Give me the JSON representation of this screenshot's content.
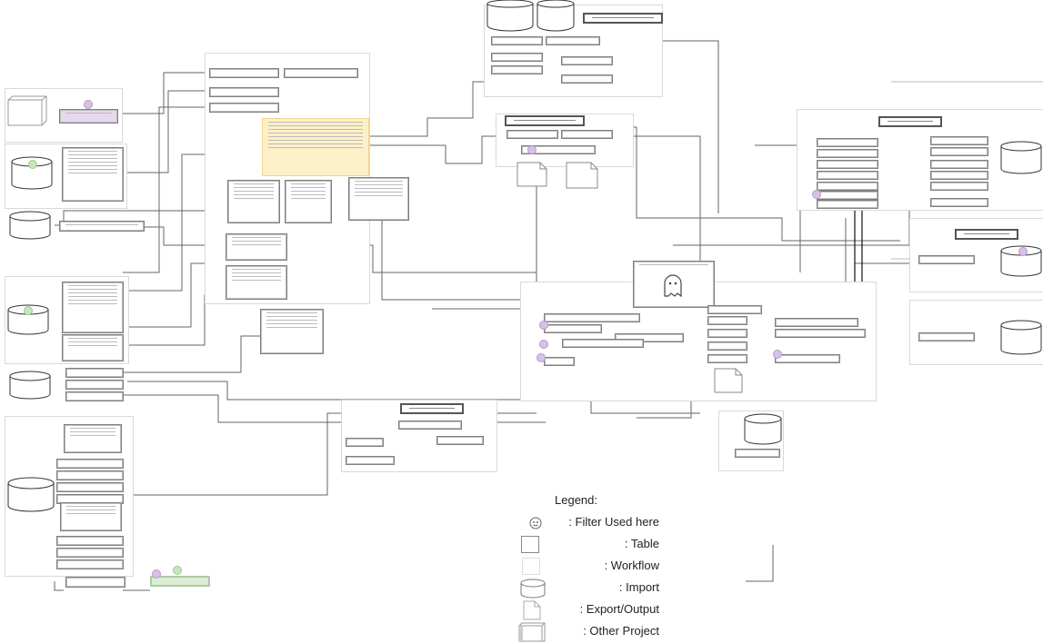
{
  "diagram": {
    "type": "data-flow diagram",
    "node_labels_legible": false
  },
  "legend": {
    "title": "Legend:",
    "items": [
      {
        "icon": "smiley-filter-icon",
        "label": ": Filter Used here"
      },
      {
        "icon": "table-box-icon",
        "label": ": Table"
      },
      {
        "icon": "workflow-box-icon",
        "label": ": Workflow"
      },
      {
        "icon": "cylinder-import-icon",
        "label": ": Import"
      },
      {
        "icon": "document-export-icon",
        "label": ": Export/Output"
      },
      {
        "icon": "3d-box-other-project-icon",
        "label": ": Other Project"
      }
    ]
  },
  "colors": {
    "highlight_node": "#fdf0c8",
    "other_project_node": "#e6d9ee",
    "output_node_green": "#dcedd5",
    "filter_marker": "#d7c0e6",
    "import_marker_green": "#c7e6bd"
  }
}
